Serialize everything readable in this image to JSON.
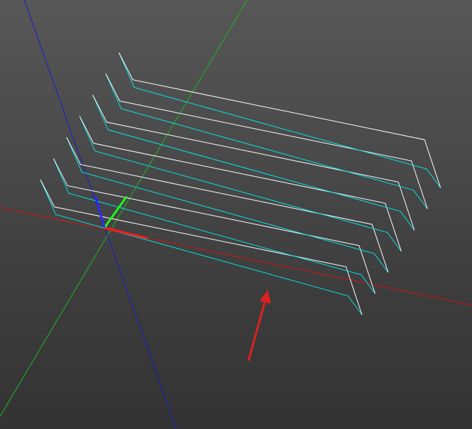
{
  "viewport": {
    "background_top": "#575757",
    "background_bottom": "#333333"
  },
  "colors": {
    "x_axis": "#ff0000",
    "y_axis": "#00ff00",
    "z_axis": "#0000ff",
    "toolpath_white": "#ffffff",
    "toolpath_cyan": "#00e5e5",
    "annotation_arrow": "#e02020"
  },
  "scene": {
    "toolpath_layer_count": 7,
    "annotation": "red-arrow"
  }
}
